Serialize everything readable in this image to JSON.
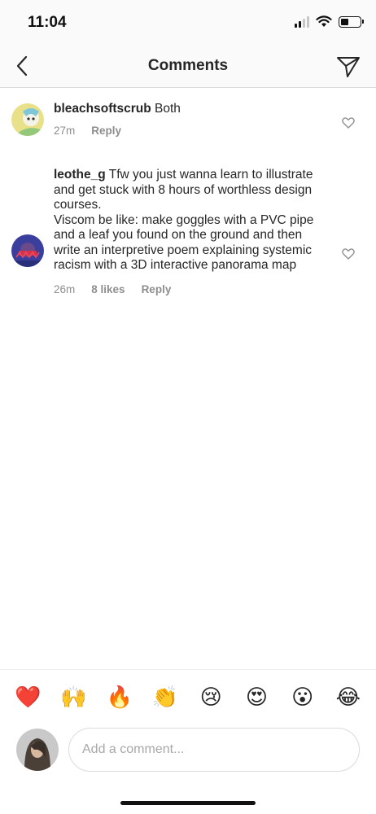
{
  "status_bar": {
    "time": "11:04",
    "icons": [
      "signal-icon",
      "wifi-icon",
      "battery-icon"
    ]
  },
  "header": {
    "title": "Comments",
    "back_icon": "chevron-left-icon",
    "send_icon": "paper-plane-icon"
  },
  "comments": [
    {
      "username": "bleachsoftscrub",
      "text": "Both",
      "text_extra": "",
      "time": "27m",
      "likes": "",
      "reply_label": "Reply"
    },
    {
      "username": "leothe_g",
      "text": "Tfw you just wanna learn to illustrate and get stuck with 8 hours of worthless design courses.",
      "text_extra": "Viscom be like: make goggles with a PVC pipe and a leaf you found on the ground and then write an interpretive poem explaining systemic racism with a 3D interactive panorama map",
      "time": "26m",
      "likes": "8 likes",
      "reply_label": "Reply"
    }
  ],
  "emoji_bar": [
    "❤️",
    "🙌",
    "🔥",
    "👏",
    "😢",
    "😍",
    "😮",
    "😂"
  ],
  "input": {
    "placeholder": "Add a comment..."
  },
  "colors": {
    "text": "#262626",
    "meta": "#8e8e8e",
    "border": "#dbdbdb",
    "header_bg": "#fafafa"
  }
}
